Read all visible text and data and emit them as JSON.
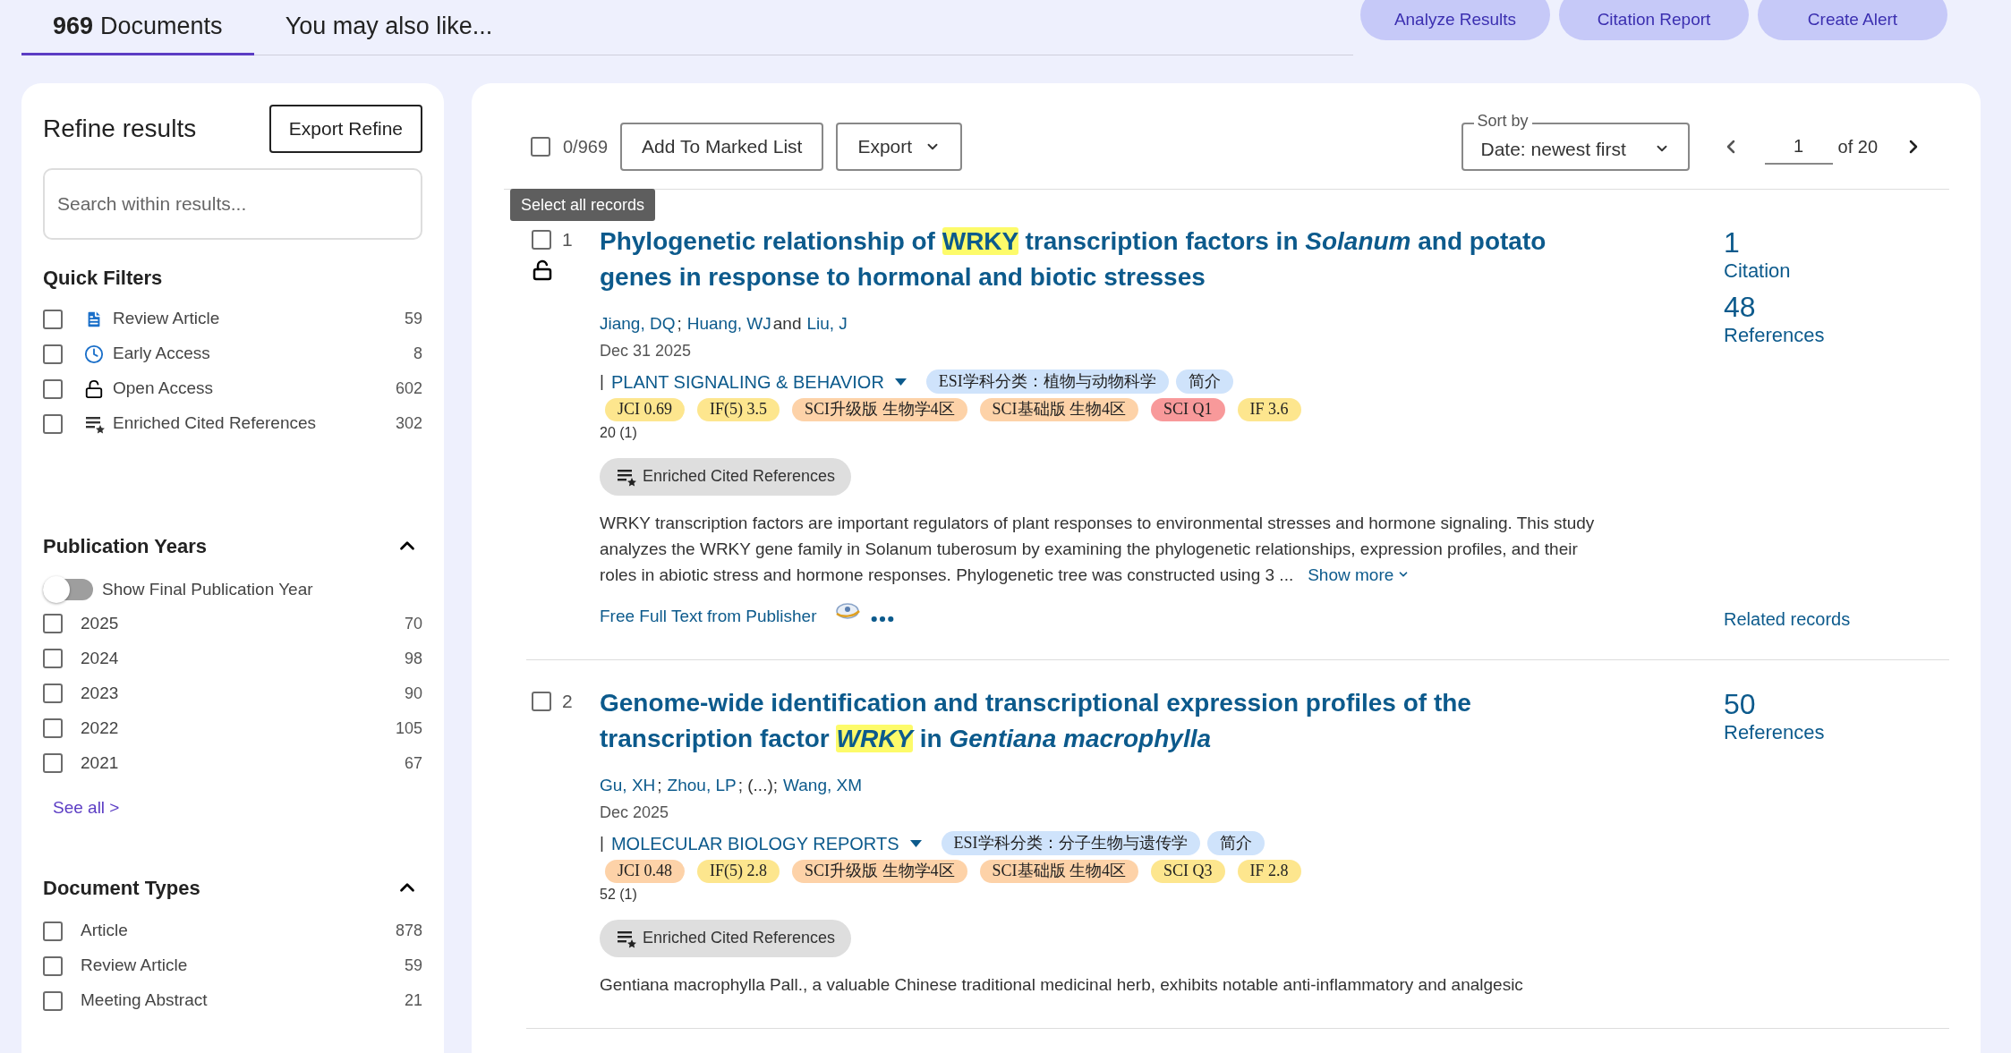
{
  "tabs": [
    {
      "count": "969",
      "label": "Documents",
      "selected": true
    },
    {
      "label": "You may also like...",
      "selected": false
    }
  ],
  "top_buttons": [
    "Analyze Results",
    "Citation Report",
    "Create Alert"
  ],
  "sidebar": {
    "title": "Refine results",
    "export_button": "Export Refine",
    "search": {
      "placeholder": "Search within results..."
    },
    "quick_filters": {
      "title": "Quick Filters",
      "items": [
        {
          "kind": "document",
          "label": "Review Article",
          "count": "59",
          "checked": false
        },
        {
          "kind": "clock",
          "label": "Early Access",
          "count": "8",
          "checked": false
        },
        {
          "kind": "lock",
          "label": "Open Access",
          "count": "602",
          "checked": false
        },
        {
          "kind": "list-star",
          "label": "Enriched Cited References",
          "count": "302",
          "checked": false
        }
      ]
    },
    "publication_years": {
      "title": "Publication Years",
      "expanded": true,
      "toggle": {
        "label": "Show Final Publication Year",
        "on": false
      },
      "items": [
        {
          "label": "2025",
          "count": "70",
          "checked": false
        },
        {
          "label": "2024",
          "count": "98",
          "checked": false
        },
        {
          "label": "2023",
          "count": "90",
          "checked": false
        },
        {
          "label": "2022",
          "count": "105",
          "checked": false
        },
        {
          "label": "2021",
          "count": "67",
          "checked": false
        }
      ],
      "see_all": "See all >"
    },
    "document_types": {
      "title": "Document Types",
      "expanded": true,
      "items": [
        {
          "label": "Article",
          "count": "878",
          "checked": false
        },
        {
          "label": "Review Article",
          "count": "59",
          "checked": false
        },
        {
          "label": "Meeting Abstract",
          "count": "21",
          "checked": false
        }
      ]
    }
  },
  "toolbar": {
    "select_all": {
      "checked": false,
      "count": "0/969",
      "tooltip": "Select all records"
    },
    "add_button": "Add To Marked List",
    "export_button": "Export",
    "sort": {
      "label": "Sort by",
      "value": "Date: newest first"
    },
    "page": {
      "value": "1",
      "of": "of 20"
    }
  },
  "records": [
    {
      "number": "1",
      "checked": false,
      "open_access": true,
      "title": [
        {
          "text": "Phylogenetic relationship of ",
          "kind": "plain"
        },
        {
          "text": "WRKY",
          "kind": "highlight"
        },
        {
          "text": " transcription factors in ",
          "kind": "plain"
        },
        {
          "text": "Solanum",
          "kind": "italic"
        },
        {
          "text": " and potato genes in response to hormonal and biotic stresses",
          "kind": "plain"
        }
      ],
      "authors": [
        {
          "text": "Jiang, DQ",
          "kind": "link"
        },
        {
          "text": ";",
          "kind": "plain"
        },
        {
          "text": "Huang, WJ",
          "kind": "link"
        },
        {
          "text": "and",
          "kind": "plain"
        },
        {
          "text": "Liu, J",
          "kind": "link"
        }
      ],
      "date": "Dec 31 2025",
      "journal_prefix": "|",
      "journal": "PLANT SIGNALING & BEHAVIOR",
      "tags": [
        "ESI学科分类：植物与动物科学",
        "简介"
      ],
      "badges": [
        {
          "text": "JCI 0.69",
          "color": "#fde68e"
        },
        {
          "text": "IF(5) 3.5",
          "color": "#fde68e"
        },
        {
          "text": "SCI升级版 生物学4区",
          "color": "#fdd2a8"
        },
        {
          "text": "SCI基础版 生物4区",
          "color": "#fdd2a8"
        },
        {
          "text": "SCI Q1",
          "color": "#f8999a"
        },
        {
          "text": "IF 3.6",
          "color": "#fde68e"
        }
      ],
      "counts": "20 (1)",
      "enriched_button": "Enriched Cited References",
      "abstract": "WRKY transcription factors are important regulators of plant responses to environmental stresses and hormone signaling. This study analyzes the WRKY gene family in Solanum tuberosum by examining the phylogenetic relationships, expression profiles, and their roles in abiotic stress and hormone responses. Phylogenetic tree was constructed using 3 ...",
      "show_more": "Show more",
      "full_text_link": "Free Full Text from Publisher",
      "metrics": [
        {
          "value": "1",
          "label": "Citation"
        },
        {
          "value": "48",
          "label": "References"
        }
      ],
      "related": "Related records"
    },
    {
      "number": "2",
      "checked": false,
      "open_access": false,
      "title": [
        {
          "text": "Genome-wide identification and transcriptional expression profiles of the transcription factor ",
          "kind": "plain"
        },
        {
          "text": "WRKY",
          "kind": "highlight-italic"
        },
        {
          "text": " in ",
          "kind": "plain"
        },
        {
          "text": "Gentiana macrophylla",
          "kind": "italic"
        }
      ],
      "authors": [
        {
          "text": "Gu, XH",
          "kind": "link"
        },
        {
          "text": ";",
          "kind": "plain"
        },
        {
          "text": "Zhou, LP",
          "kind": "link"
        },
        {
          "text": "; (...);",
          "kind": "plain"
        },
        {
          "text": "Wang, XM",
          "kind": "link"
        }
      ],
      "date": "Dec 2025",
      "journal_prefix": "|",
      "journal": "MOLECULAR BIOLOGY REPORTS",
      "tags": [
        "ESI学科分类：分子生物与遗传学",
        "简介"
      ],
      "badges": [
        {
          "text": "JCI 0.48",
          "color": "#fdd2a8"
        },
        {
          "text": "IF(5) 2.8",
          "color": "#fde68e"
        },
        {
          "text": "SCI升级版 生物学4区",
          "color": "#fdd2a8"
        },
        {
          "text": "SCI基础版 生物4区",
          "color": "#fdd2a8"
        },
        {
          "text": "SCI Q3",
          "color": "#fde68e"
        },
        {
          "text": "IF 2.8",
          "color": "#fde68e"
        }
      ],
      "counts": "52 (1)",
      "enriched_button": "Enriched Cited References",
      "abstract": "Gentiana macrophylla Pall., a valuable Chinese traditional medicinal herb, exhibits notable anti-inflammatory and analgesic",
      "metrics": [
        {
          "value": "50",
          "label": "References"
        }
      ]
    }
  ]
}
